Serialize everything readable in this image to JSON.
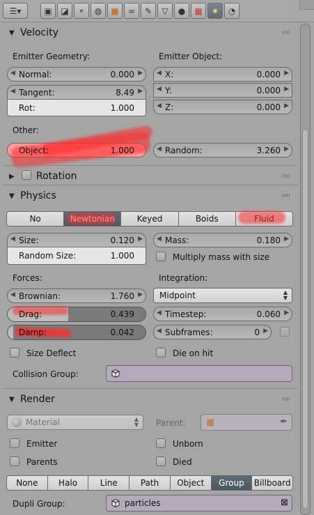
{
  "toolbar": {
    "icons": [
      "editor-type-icon",
      "render-icon",
      "scene-icon",
      "world-icon",
      "object-icon",
      "constraints-icon",
      "modifiers-icon",
      "data-icon",
      "material-icon",
      "texture-icon",
      "particles-icon",
      "physics-icon"
    ],
    "active": "particles-icon"
  },
  "velocity": {
    "title": "Velocity",
    "emitter_geometry_label": "Emitter Geometry:",
    "emitter_object_label": "Emitter Object:",
    "normal_label": "Normal:",
    "normal_value": "0.000",
    "tangent_label": "Tangent:",
    "tangent_value": "8.49",
    "rot_label": "Rot:",
    "rot_value": "1.000",
    "x_label": "X:",
    "x_value": "0.000",
    "y_label": "Y:",
    "y_value": "0.000",
    "z_label": "Z:",
    "z_value": "0.000",
    "other_label": "Other:",
    "object_label": "Object:",
    "object_value": "1.000",
    "random_label": "Random:",
    "random_value": "3.260"
  },
  "rotation": {
    "title": "Rotation"
  },
  "physics": {
    "title": "Physics",
    "types": [
      "No",
      "Newtonian",
      "Keyed",
      "Boids",
      "Fluid"
    ],
    "selected_type": "Newtonian",
    "size_label": "Size:",
    "size_value": "0.120",
    "random_size_label": "Random Size:",
    "random_size_value": "1.000",
    "mass_label": "Mass:",
    "mass_value": "0.180",
    "multiply_mass_label": "Multiply mass with size",
    "forces_label": "Forces:",
    "integration_label": "Integration:",
    "brownian_label": "Brownian:",
    "brownian_value": "1.760",
    "integration_value": "Midpoint",
    "drag_label": "Drag:",
    "drag_value": "0.439",
    "drag_fraction": 0.439,
    "timestep_label": "Timestep:",
    "timestep_value": "0.060",
    "damp_label": "Damp:",
    "damp_value": "0.042",
    "damp_fraction": 0.042,
    "subframes_label": "Subframes:",
    "subframes_value": "0",
    "size_deflect_label": "Size Deflect",
    "die_on_hit_label": "Die on hit",
    "collision_group_label": "Collision Group:"
  },
  "render": {
    "title": "Render",
    "material_placeholder": "Material",
    "parent_label": "Parent:",
    "emitter_label": "Emitter",
    "unborn_label": "Unborn",
    "parents_label": "Parents",
    "died_label": "Died",
    "types": [
      "None",
      "Halo",
      "Line",
      "Path",
      "Object",
      "Group",
      "Billboard"
    ],
    "selected_type": "Group",
    "dupli_group_label": "Dupli Group:",
    "dupli_group_value": "particles"
  },
  "colors": {
    "selected": "#56636d",
    "annotation": "#ff2b2b",
    "panel_bg": "#a5a5a5"
  }
}
